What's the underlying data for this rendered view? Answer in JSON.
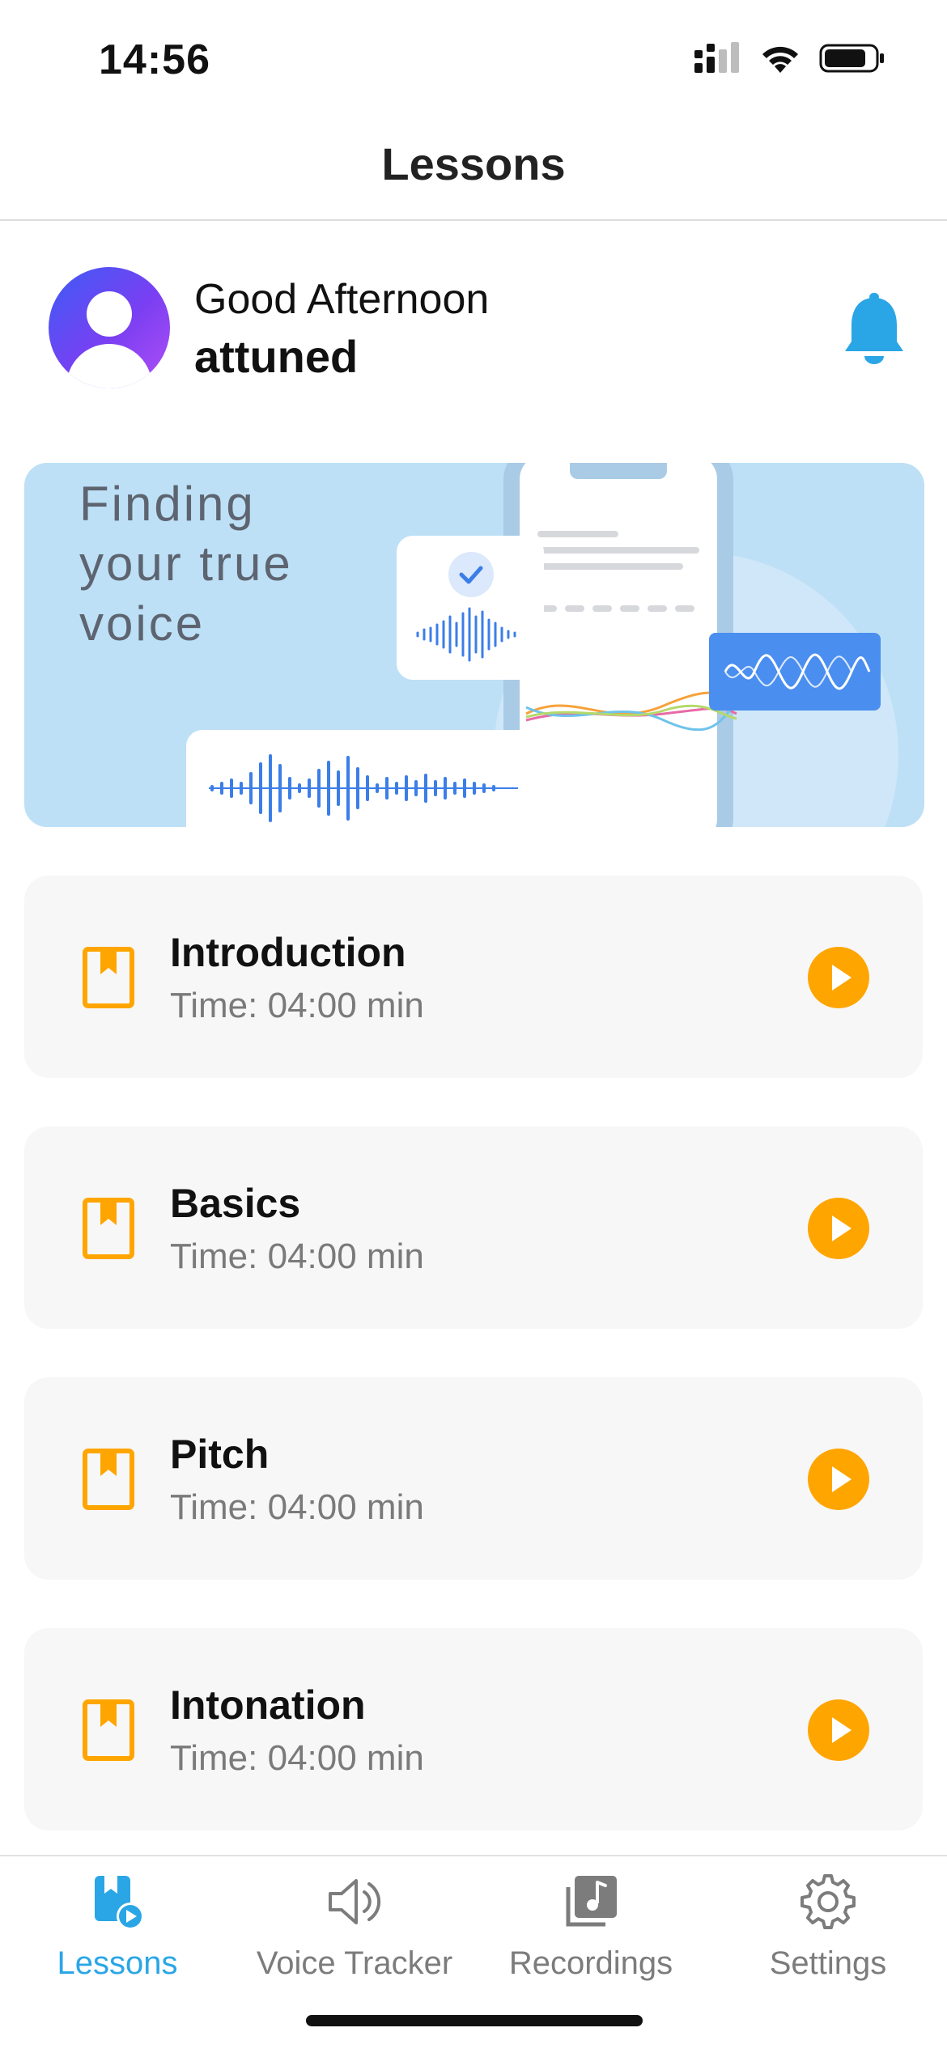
{
  "status_bar": {
    "time": "14:56"
  },
  "nav": {
    "title": "Lessons"
  },
  "greeting": {
    "line": "Good Afternoon",
    "name": "attuned"
  },
  "banner": {
    "text": "Finding\nyour true\nvoice"
  },
  "lessons": [
    {
      "title": "Introduction",
      "time": "Time: 04:00 min"
    },
    {
      "title": "Basics",
      "time": "Time: 04:00 min"
    },
    {
      "title": "Pitch",
      "time": "Time: 04:00 min"
    },
    {
      "title": "Intonation",
      "time": "Time: 04:00 min"
    }
  ],
  "tabs": [
    {
      "label": "Lessons",
      "icon": "lessons-icon",
      "active": true
    },
    {
      "label": "Voice Tracker",
      "icon": "speaker-icon",
      "active": false
    },
    {
      "label": "Recordings",
      "icon": "music-library-icon",
      "active": false
    },
    {
      "label": "Settings",
      "icon": "gear-icon",
      "active": false
    }
  ],
  "colors": {
    "accent": "#2aa6e6",
    "play": "#ffa500",
    "book": "#ffa500",
    "banner_bg": "#bde0f6"
  }
}
